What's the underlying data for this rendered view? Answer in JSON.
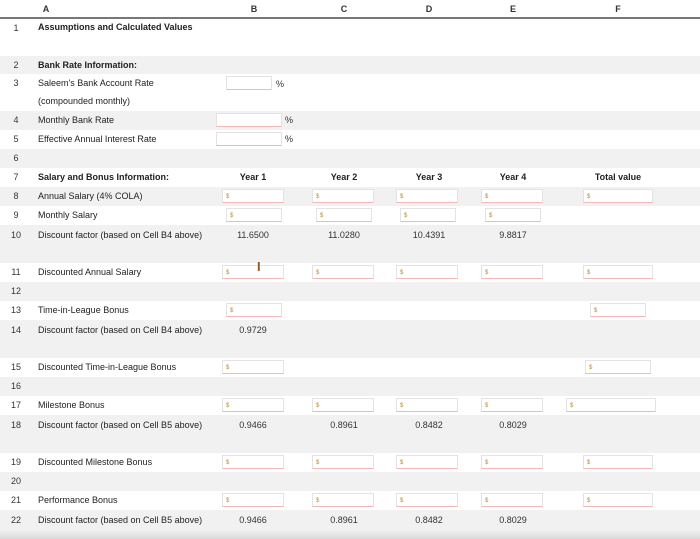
{
  "columns": [
    "A",
    "B",
    "C",
    "D",
    "E",
    "F"
  ],
  "row_numbers": [
    "1",
    "2",
    "3",
    "4",
    "5",
    "6",
    "7",
    "8",
    "9",
    "10",
    "11",
    "12",
    "13",
    "14",
    "15",
    "16",
    "17",
    "18",
    "19",
    "20",
    "21",
    "22"
  ],
  "labels": {
    "r1": "Assumptions and Calculated Values",
    "r2": "Bank Rate Information:",
    "r3": "Saleem's Bank Account Rate (compounded monthly)",
    "r4": "Monthly Bank Rate",
    "r5": "Effective Annual Interest Rate",
    "r7": "Salary and Bonus Information:",
    "r8": "Annual Salary (4% COLA)",
    "r9": "Monthly Salary",
    "r10": "Discount factor (based on Cell B4 above)",
    "r11": "Discounted Annual Salary",
    "r13": "Time-in-League Bonus",
    "r14": "Discount factor (based on Cell B4 above)",
    "r15": "Discounted Time-in-League Bonus",
    "r17": "Milestone Bonus",
    "r18": "Discount factor (based on Cell B5 above)",
    "r19": "Discounted Milestone Bonus",
    "r21": "Performance Bonus",
    "r22": "Discount factor (based on Cell B5 above)"
  },
  "year_headers": [
    "Year 1",
    "Year 2",
    "Year 3",
    "Year 4",
    "Total value"
  ],
  "percent_sign": "%",
  "dollar_sign": "$",
  "values": {
    "r10": [
      "11.6500",
      "11.0280",
      "10.4391",
      "9.8817"
    ],
    "r14": [
      "0.9729"
    ],
    "r18": [
      "0.9466",
      "0.8961",
      "0.8482",
      "0.8029"
    ],
    "r22": [
      "0.9466",
      "0.8961",
      "0.8482",
      "0.8029"
    ]
  },
  "cursor_glyph": "I"
}
